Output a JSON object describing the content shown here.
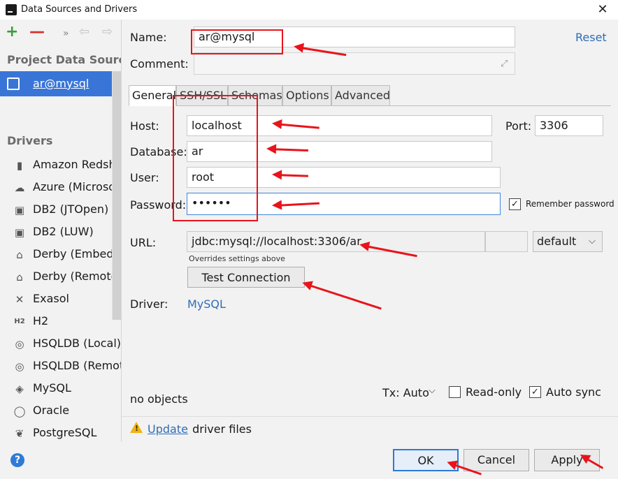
{
  "window": {
    "title": "Data Sources and Drivers",
    "close_glyph": "✕"
  },
  "toolbar": {
    "add_glyph": "+",
    "remove_glyph": "—",
    "more_glyph": "»",
    "back_glyph": "⇦",
    "forward_glyph": "⇨"
  },
  "sidebar": {
    "project_heading": "Project Data Sources",
    "selected_source": "ar@mysql",
    "drivers_heading": "Drivers",
    "drivers": [
      {
        "label": "Amazon Redshift",
        "icon": "redshift-icon",
        "glyph": "▮"
      },
      {
        "label": "Azure (Microsoft",
        "icon": "azure-cloud-icon",
        "glyph": "☁"
      },
      {
        "label": "DB2 (JTOpen)",
        "icon": "db2-icon",
        "glyph": "▣"
      },
      {
        "label": "DB2 (LUW)",
        "icon": "db2-icon",
        "glyph": "▣"
      },
      {
        "label": "Derby (Embedde",
        "icon": "derby-hat-icon",
        "glyph": "⌂"
      },
      {
        "label": "Derby (Remote)",
        "icon": "derby-hat-icon",
        "glyph": "⌂"
      },
      {
        "label": "Exasol",
        "icon": "exasol-icon",
        "glyph": "✕"
      },
      {
        "label": "H2",
        "icon": "h2-icon",
        "glyph": "H2"
      },
      {
        "label": "HSQLDB (Local)",
        "icon": "hsqldb-icon",
        "glyph": "◎"
      },
      {
        "label": "HSQLDB (Remote",
        "icon": "hsqldb-icon",
        "glyph": "◎"
      },
      {
        "label": "MySQL",
        "icon": "mysql-icon",
        "glyph": "◈"
      },
      {
        "label": "Oracle",
        "icon": "oracle-icon",
        "glyph": "◯"
      },
      {
        "label": "PostgreSQL",
        "icon": "postgresql-icon",
        "glyph": "❦"
      }
    ]
  },
  "form": {
    "name_label": "Name:",
    "name_value": "ar@mysql",
    "comment_label": "Comment:",
    "comment_value": "",
    "reset_label": "Reset",
    "tabs": [
      "General",
      "SSH/SSL",
      "Schemas",
      "Options",
      "Advanced"
    ],
    "active_tab": "General",
    "host_label": "Host:",
    "host_value": "localhost",
    "port_label": "Port:",
    "port_value": "3306",
    "database_label": "Database:",
    "database_value": "ar",
    "user_label": "User:",
    "user_value": "root",
    "password_label": "Password:",
    "password_value": "••••••",
    "remember_password_label": "Remember password",
    "remember_password_checked": true,
    "url_label": "URL:",
    "url_value": "jdbc:mysql://localhost:3306/ar",
    "url_mode": "default",
    "url_hint": "Overrides settings above",
    "test_connection_label": "Test Connection",
    "driver_label": "Driver:",
    "driver_value": "MySQL",
    "objects_status": "no objects",
    "tx_label": "Tx: Auto",
    "readonly_label": "Read-only",
    "readonly_checked": false,
    "autosync_label": "Auto sync",
    "autosync_checked": true,
    "update_link": "Update",
    "update_rest": " driver files"
  },
  "buttons": {
    "ok": "OK",
    "cancel": "Cancel",
    "apply": "Apply",
    "help": "?"
  },
  "colors": {
    "accent": "#3875d7",
    "link": "#2f6db5",
    "annotation": "#e8141b",
    "warning": "#f1b211"
  }
}
